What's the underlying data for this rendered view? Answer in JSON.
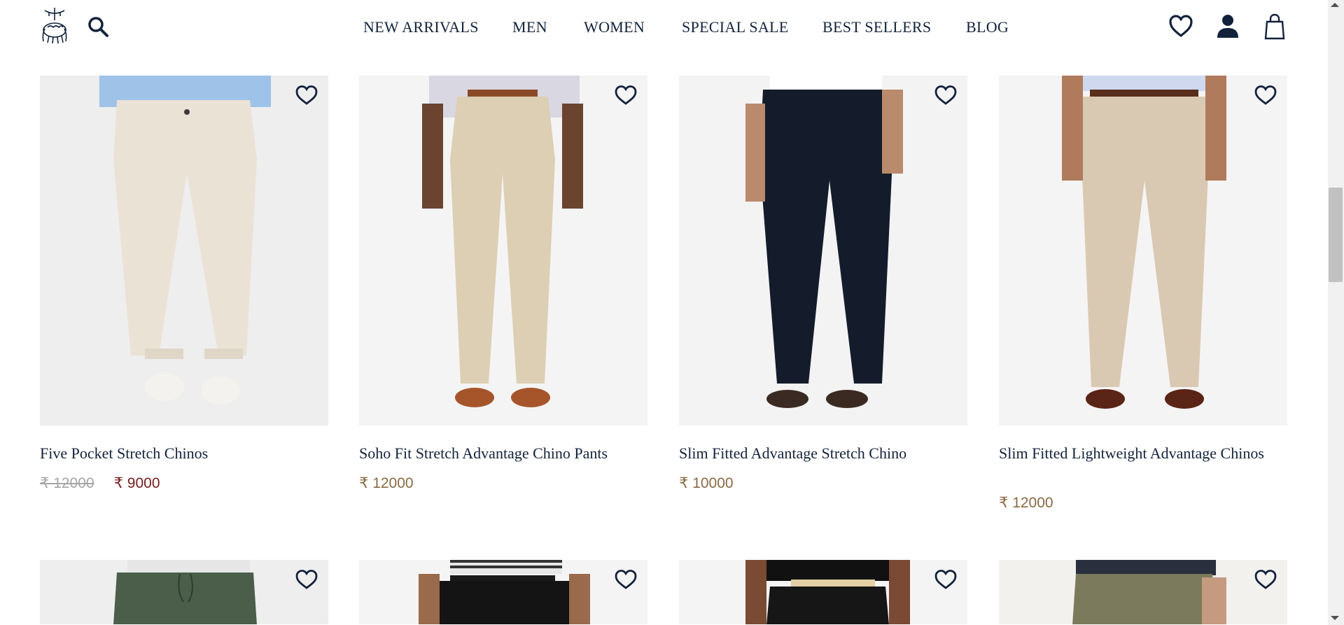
{
  "header": {
    "logo_icon": "golden-fleece-logo-icon",
    "search_icon": "search-icon",
    "nav": [
      "NEW ARRIVALS",
      "MEN",
      "WOMEN",
      "SPECIAL SALE",
      "BEST SELLERS",
      "BLOG"
    ],
    "wishlist_icon": "heart-icon",
    "account_icon": "user-icon",
    "bag_icon": "shopping-bag-icon"
  },
  "colors": {
    "navy": "#13223b",
    "sale_red": "#7a1d1d",
    "price_brown": "#8a6a44",
    "strike_gray": "#a6a6a6"
  },
  "products": [
    {
      "name": "Five Pocket Stretch Chinos",
      "price_old": "₹ 12000",
      "price": "₹ 9000",
      "on_sale": true
    },
    {
      "name": "Soho Fit Stretch Advantage Chino Pants",
      "price": "₹ 12000",
      "on_sale": false
    },
    {
      "name": "Slim Fitted Advantage Stretch Chino",
      "price": "₹ 10000",
      "on_sale": false
    },
    {
      "name": "Slim Fitted Lightweight Advantage Chinos",
      "price": "₹ 12000",
      "on_sale": false
    }
  ],
  "next_row_images": [
    "green-jogger-image",
    "black-chino-image",
    "black-chino-belt-image",
    "olive-pants-image"
  ]
}
